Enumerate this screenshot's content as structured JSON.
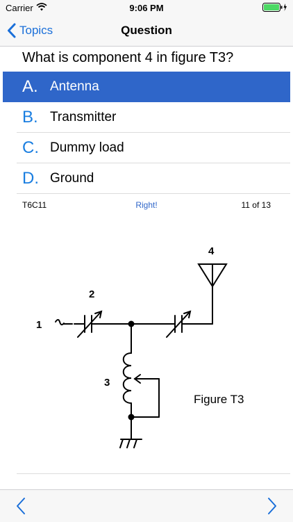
{
  "status_bar": {
    "carrier": "Carrier",
    "time": "9:06 PM",
    "battery_color": "#4cd964"
  },
  "nav": {
    "back_label": "Topics",
    "title": "Question",
    "accent_color": "#1a6fd9"
  },
  "question": {
    "text": "What is component 4 in figure T3?"
  },
  "answers": [
    {
      "letter": "A.",
      "text": "Antenna",
      "selected": true
    },
    {
      "letter": "B.",
      "text": "Transmitter",
      "selected": false
    },
    {
      "letter": "C.",
      "text": "Dummy load",
      "selected": false
    },
    {
      "letter": "D.",
      "text": "Ground",
      "selected": false
    }
  ],
  "info": {
    "question_id": "T6C11",
    "result": "Right!",
    "progress": "11 of 13"
  },
  "figure": {
    "label_1": "1",
    "label_2": "2",
    "label_3": "3",
    "label_4": "4",
    "caption": "Figure T3"
  },
  "toolbar": {
    "prev_icon": "chevron-left-icon",
    "next_icon": "chevron-right-icon"
  }
}
